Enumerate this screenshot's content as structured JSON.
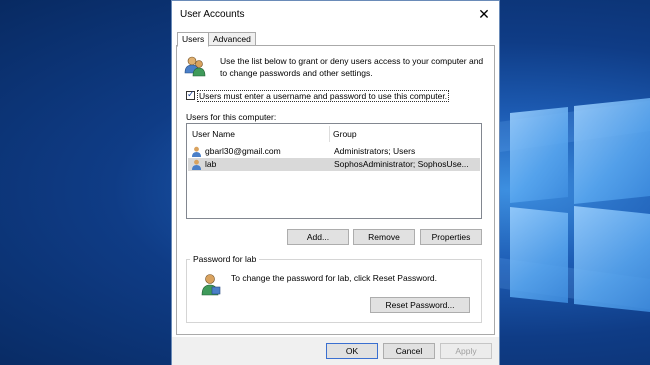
{
  "dialog": {
    "title": "User Accounts",
    "close_glyph": "✕"
  },
  "tabs": [
    {
      "label": "Users",
      "active": true
    },
    {
      "label": "Advanced",
      "active": false
    }
  ],
  "users_tab": {
    "icon": "users-icon",
    "intro_line1": "Use the list below to grant or deny users access to your computer and",
    "intro_line2": "to change passwords and other settings.",
    "require_login_checkbox": {
      "label": "Users must enter a username and password to use this computer.",
      "checked": true
    },
    "list_label": "Users for this computer:",
    "columns": [
      "User Name",
      "Group"
    ],
    "rows": [
      {
        "name": "gbarl30@gmail.com",
        "group": "Administrators; Users",
        "icon": "user-icon",
        "selected": false
      },
      {
        "name": "lab",
        "group": "SophosAdministrator; SophosUse...",
        "icon": "user-icon",
        "selected": true
      }
    ],
    "add_label": "Add...",
    "remove_label": "Remove",
    "properties_label": "Properties",
    "password_group": {
      "title": "Password for lab",
      "icon": "password-user-icon",
      "text": "To change the password for lab, click Reset Password.",
      "reset_label": "Reset Password..."
    }
  },
  "footer": {
    "ok_label": "OK",
    "cancel_label": "Cancel",
    "apply_label": "Apply"
  },
  "colors": {
    "desktop_bg": "#0f3c86",
    "selected_row": "#d9d9d9",
    "accent_border": "#3a6fd0"
  }
}
